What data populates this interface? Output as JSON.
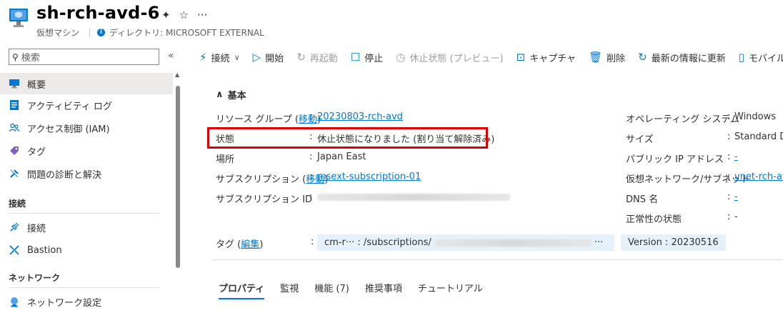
{
  "header": {
    "title": "sh-rch-avd-6",
    "resource_type": "仮想マシン",
    "directory": "ディレクトリ: MICROSOFT EXTERNAL",
    "pin_glyph": "✦",
    "star_glyph": "☆",
    "more_glyph": "···"
  },
  "sidebar": {
    "search_placeholder": "検索",
    "collapse_glyph": "«",
    "items": [
      {
        "label": "概要",
        "icon": "monitor-icon"
      },
      {
        "label": "アクティビティ ログ",
        "icon": "log-icon"
      },
      {
        "label": "アクセス制御 (IAM)",
        "icon": "people-icon"
      },
      {
        "label": "タグ",
        "icon": "tag-icon"
      },
      {
        "label": "問題の診断と解決",
        "icon": "wrench-icon"
      }
    ],
    "group_connect": "接続",
    "connect_items": [
      {
        "label": "接続",
        "icon": "plug-icon"
      },
      {
        "label": "Bastion",
        "icon": "bastion-icon"
      }
    ],
    "group_network": "ネットワーク",
    "network_items": [
      {
        "label": "ネットワーク設定",
        "icon": "network-icon"
      }
    ]
  },
  "toolbar": {
    "connect": "接続",
    "start": "開始",
    "restart": "再起動",
    "stop": "停止",
    "hibernate": "休止状態 (プレビュー)",
    "capture": "キャプチャ",
    "delete": "削除",
    "refresh": "最新の情報に更新",
    "mobile": "モバイル"
  },
  "essentials": {
    "section_title": "基本",
    "resource_group_label": "リソース グループ (",
    "move_link": "移動",
    "label_close": ")",
    "resource_group_value": "20230803-rch-avd",
    "status_label": "状態",
    "status_value": "休止状態になりました (割り当て解除済み)",
    "location_label": "場所",
    "location_value": "Japan East",
    "subscription_label": "サブスクリプション (",
    "subscription_value": "msext-subscription-01",
    "subscription_id_label": "サブスクリプション ID",
    "os_label": "オペレーティング システム",
    "os_value": "Windows",
    "size_label": "サイズ",
    "size_value": "Standard D",
    "public_ip_label": "パブリック IP アドレス",
    "public_ip_value": "-",
    "vnet_label": "仮想ネットワーク/サブネット",
    "vnet_value": "vnet-rch-av",
    "dns_label": "DNS 名",
    "dns_value": "-",
    "health_label": "正常性の状態",
    "health_value": "-",
    "tags_label": "タグ (",
    "tags_edit_link": "編集",
    "tag1_prefix": "cm-r··· : /subscriptions/",
    "tag1_suffix": "···",
    "tag2": "Version : 20230516",
    "colon": ":"
  },
  "tabs": [
    "プロパティ",
    "監視",
    "機能 (7)",
    "推奨事項",
    "チュートリアル"
  ]
}
